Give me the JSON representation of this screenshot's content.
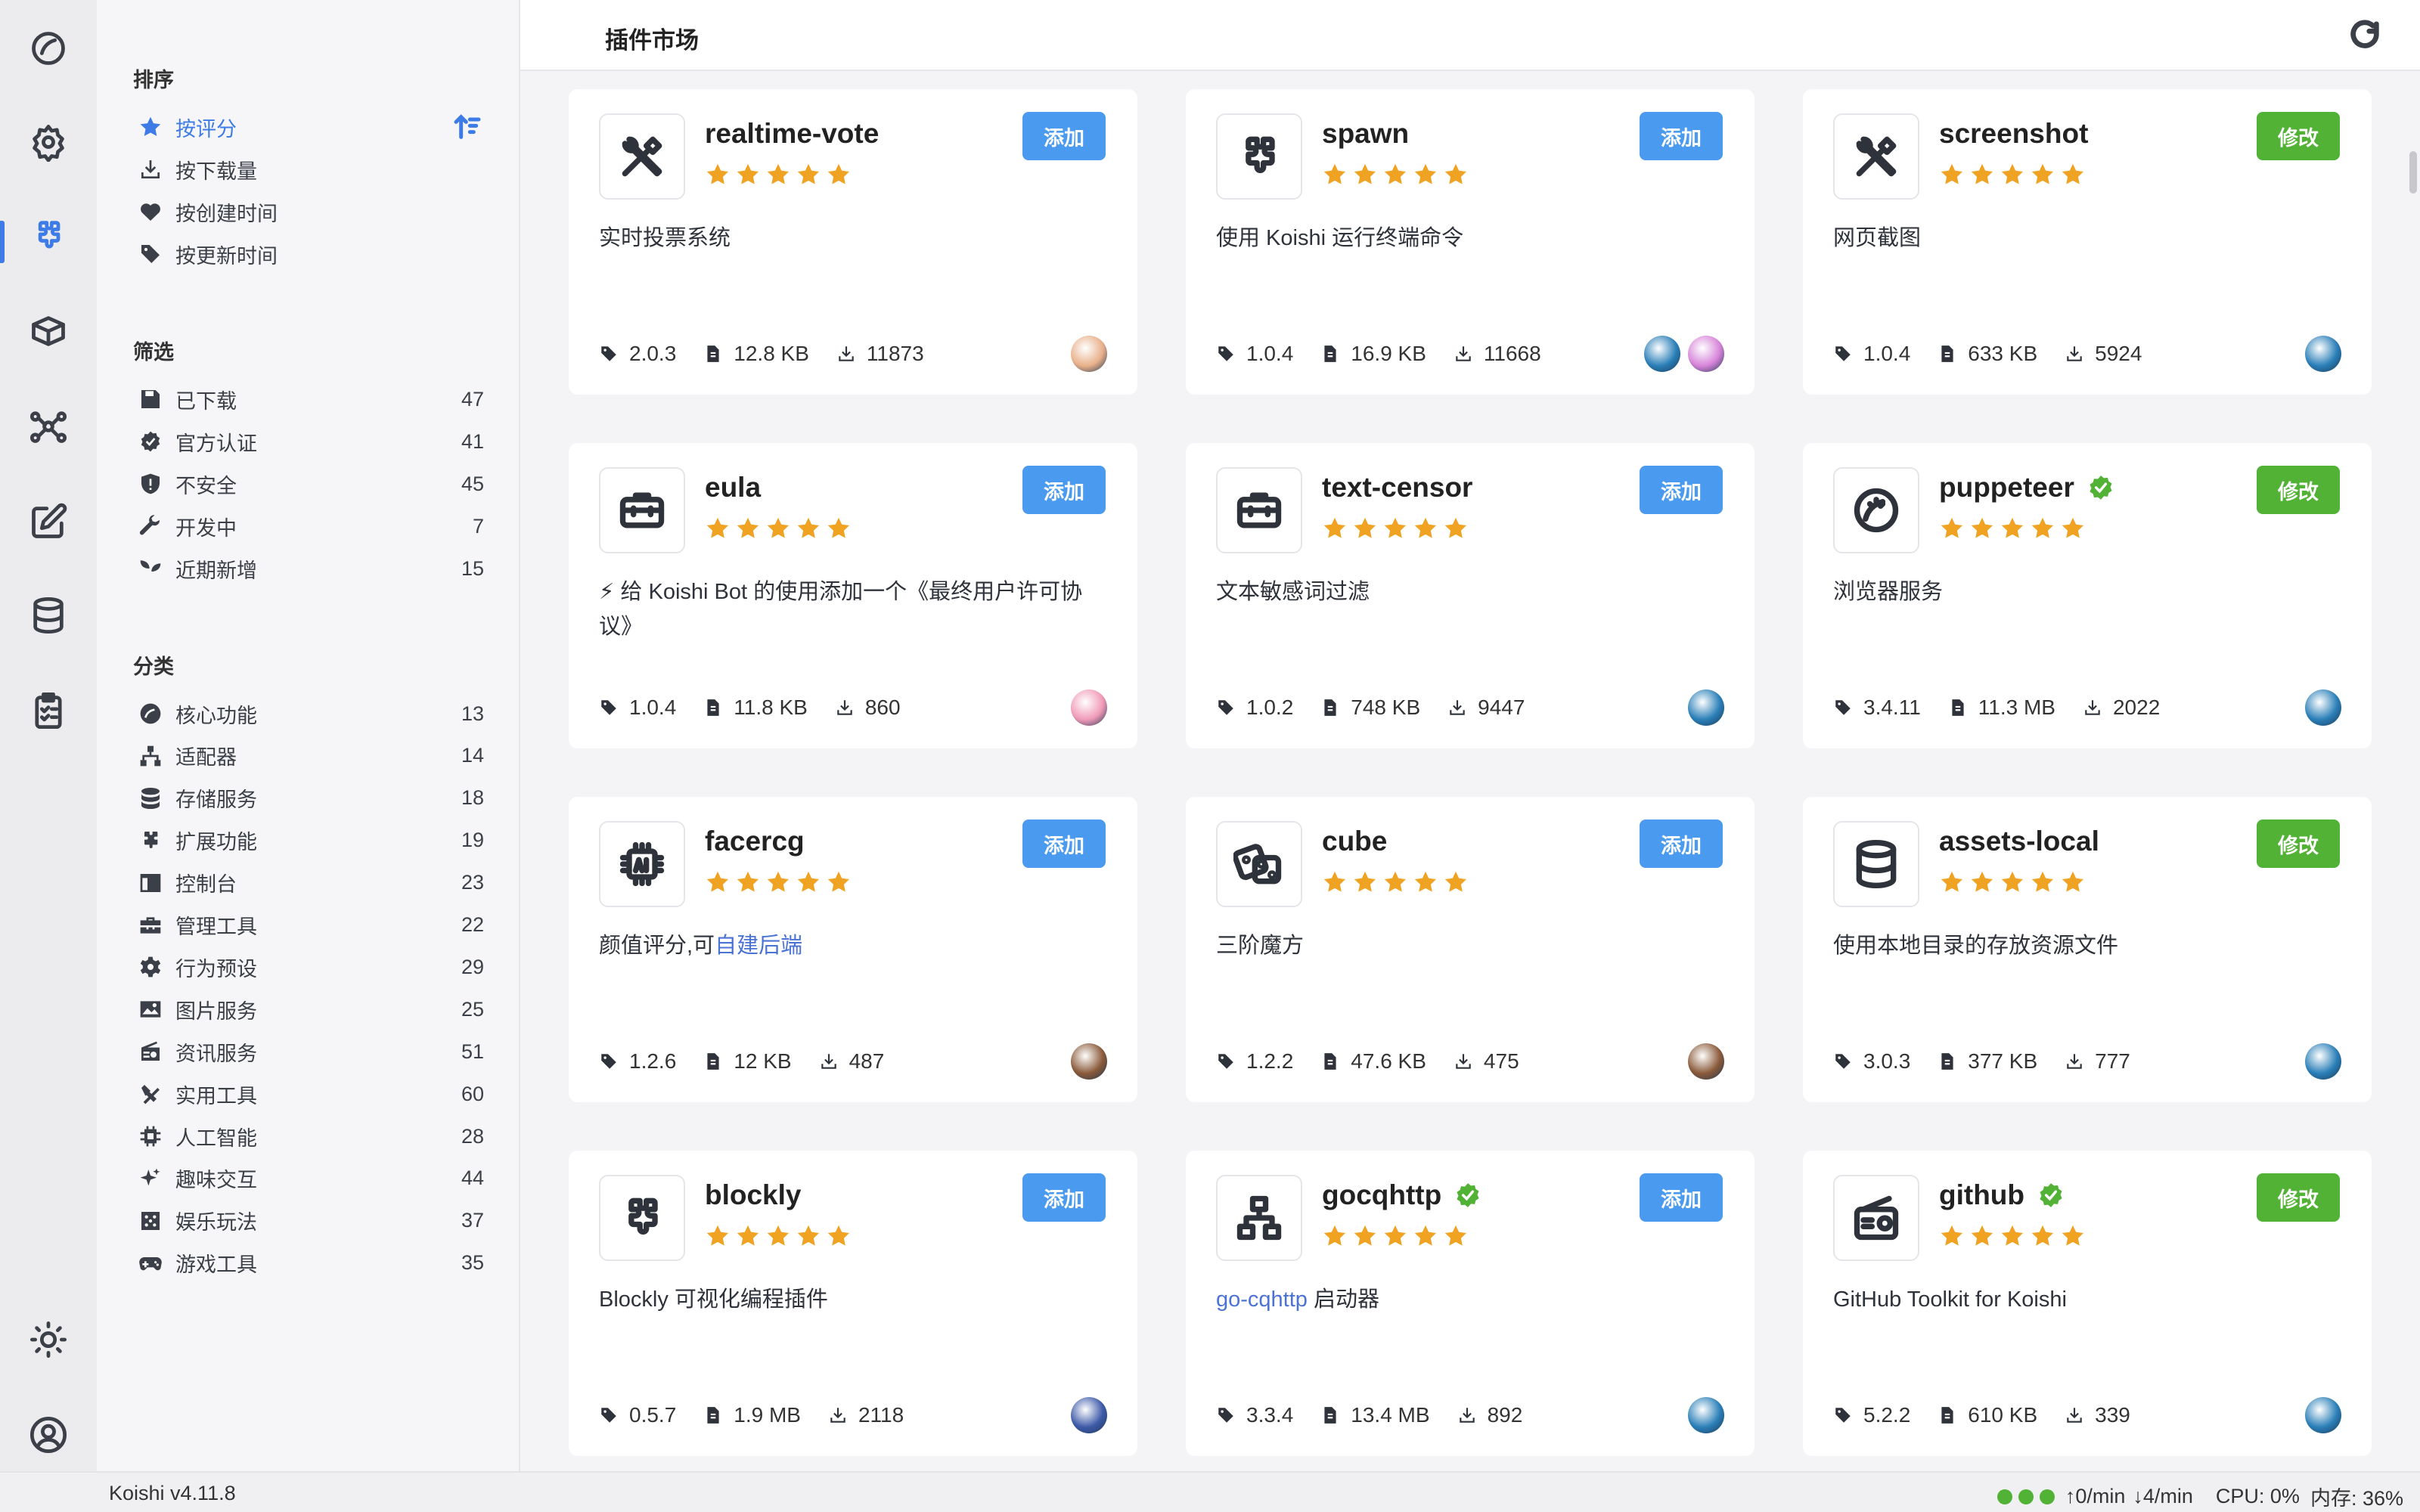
{
  "app": {
    "version": "Koishi v4.11.8"
  },
  "activity_bar": {
    "icons": [
      "dashboard-icon",
      "settings-icon",
      "plugin-icon",
      "package-icon",
      "network-icon",
      "edit-icon",
      "database-icon",
      "clipboard-icon",
      "theme-icon",
      "user-icon"
    ],
    "active": "plugin-icon"
  },
  "sidebar": {
    "sort_title": "排序",
    "sort": [
      {
        "label": "按评分",
        "icon": "star-icon",
        "active": true
      },
      {
        "label": "按下载量",
        "icon": "download-icon"
      },
      {
        "label": "按创建时间",
        "icon": "heart-pulse-icon"
      },
      {
        "label": "按更新时间",
        "icon": "tag-icon"
      }
    ],
    "filter_title": "筛选",
    "filters": [
      {
        "label": "已下载",
        "count": "47",
        "icon": "save-icon"
      },
      {
        "label": "官方认证",
        "count": "41",
        "icon": "badge-check-icon"
      },
      {
        "label": "不安全",
        "count": "45",
        "icon": "shield-alert-icon"
      },
      {
        "label": "开发中",
        "count": "7",
        "icon": "wrench-icon"
      },
      {
        "label": "近期新增",
        "count": "15",
        "icon": "seedling-icon"
      }
    ],
    "category_title": "分类",
    "categories": [
      {
        "label": "核心功能",
        "count": "13",
        "icon": "gauge-icon"
      },
      {
        "label": "适配器",
        "count": "14",
        "icon": "sitemap-icon"
      },
      {
        "label": "存储服务",
        "count": "18",
        "icon": "database-icon"
      },
      {
        "label": "扩展功能",
        "count": "19",
        "icon": "puzzle-icon"
      },
      {
        "label": "控制台",
        "count": "23",
        "icon": "console-icon"
      },
      {
        "label": "管理工具",
        "count": "22",
        "icon": "toolbox-icon"
      },
      {
        "label": "行为预设",
        "count": "29",
        "icon": "gear-icon"
      },
      {
        "label": "图片服务",
        "count": "25",
        "icon": "image-icon"
      },
      {
        "label": "资讯服务",
        "count": "51",
        "icon": "radio-icon"
      },
      {
        "label": "实用工具",
        "count": "60",
        "icon": "tools-icon"
      },
      {
        "label": "人工智能",
        "count": "28",
        "icon": "chip-icon"
      },
      {
        "label": "趣味交互",
        "count": "44",
        "icon": "sparkles-icon"
      },
      {
        "label": "娱乐玩法",
        "count": "37",
        "icon": "dice-icon"
      },
      {
        "label": "游戏工具",
        "count": "35",
        "icon": "gamepad-icon"
      }
    ]
  },
  "header": {
    "title": "插件市场"
  },
  "plugins": [
    {
      "name": "realtime-vote",
      "icon": "tools-icon",
      "action": "添加",
      "action_type": "add",
      "desc": "实时投票系统",
      "version": "2.0.3",
      "size": "12.8 KB",
      "downloads": "11873",
      "rating": 5,
      "avatars": [
        "#e8b08a"
      ]
    },
    {
      "name": "spawn",
      "icon": "puzzle-icon",
      "action": "添加",
      "action_type": "add",
      "desc": "使用 Koishi 运行终端命令",
      "version": "1.0.4",
      "size": "16.9 KB",
      "downloads": "11668",
      "rating": 5,
      "avatars": [
        "#2a7fb8",
        "#d784d9"
      ]
    },
    {
      "name": "screenshot",
      "icon": "tools-icon",
      "action": "修改",
      "action_type": "edit",
      "desc": "网页截图",
      "version": "1.0.4",
      "size": "633 KB",
      "downloads": "5924",
      "rating": 5,
      "avatars": [
        "#2a7fb8"
      ]
    },
    {
      "name": "eula",
      "icon": "toolbox-icon",
      "action": "添加",
      "action_type": "add",
      "desc": "⚡ 给 Koishi Bot 的使用添加一个《最终用户许可协议》",
      "version": "1.0.4",
      "size": "11.8 KB",
      "downloads": "860",
      "rating": 5,
      "avatars": [
        "#f09ab8"
      ]
    },
    {
      "name": "text-censor",
      "icon": "toolbox-icon",
      "action": "添加",
      "action_type": "add",
      "desc": "文本敏感词过滤",
      "version": "1.0.2",
      "size": "748 KB",
      "downloads": "9447",
      "rating": 5,
      "avatars": [
        "#2a7fb8"
      ]
    },
    {
      "name": "puppeteer",
      "icon": "gauge-icon",
      "action": "修改",
      "action_type": "edit",
      "verified": true,
      "desc": "浏览器服务",
      "version": "3.4.11",
      "size": "11.3 MB",
      "downloads": "2022",
      "rating": 5,
      "avatars": [
        "#2a7fb8"
      ]
    },
    {
      "name": "facercg",
      "icon": "chip-icon",
      "action": "添加",
      "action_type": "add",
      "desc": "颜值评分,可",
      "desc_link": "自建后端",
      "version": "1.2.6",
      "size": "12 KB",
      "downloads": "487",
      "rating": 5,
      "avatars": [
        "#8a5a3a"
      ]
    },
    {
      "name": "cube",
      "icon": "dice-icon",
      "action": "添加",
      "action_type": "add",
      "desc": "三阶魔方",
      "version": "1.2.2",
      "size": "47.6 KB",
      "downloads": "475",
      "rating": 5,
      "avatars": [
        "#8a5a3a"
      ]
    },
    {
      "name": "assets-local",
      "icon": "database-icon",
      "action": "修改",
      "action_type": "edit",
      "desc": "使用本地目录的存放资源文件",
      "version": "3.0.3",
      "size": "377 KB",
      "downloads": "777",
      "rating": 5,
      "avatars": [
        "#2a7fb8"
      ]
    },
    {
      "name": "blockly",
      "icon": "puzzle-icon",
      "action": "添加",
      "action_type": "add",
      "desc": "Blockly 可视化编程插件",
      "version": "0.5.7",
      "size": "1.9 MB",
      "downloads": "2118",
      "rating": 5,
      "avatars": [
        "#3d5aa8"
      ]
    },
    {
      "name": "gocqhttp",
      "icon": "sitemap-icon",
      "action": "添加",
      "action_type": "add",
      "verified": true,
      "desc_link_first": "go-cqhttp",
      "desc": " 启动器",
      "version": "3.3.4",
      "size": "13.4 MB",
      "downloads": "892",
      "rating": 5,
      "avatars": [
        "#2a7fb8"
      ]
    },
    {
      "name": "github",
      "icon": "radio-icon",
      "action": "修改",
      "action_type": "edit",
      "verified": true,
      "desc": "GitHub Toolkit for Koishi",
      "version": "5.2.2",
      "size": "610 KB",
      "downloads": "339",
      "rating": 5,
      "avatars": [
        "#2a7fb8"
      ]
    }
  ],
  "status": {
    "indicators": [
      "#52b235",
      "#52b235",
      "#52b235"
    ],
    "up": "0/min",
    "down": "4/min",
    "cpu": "CPU: 0%",
    "mem": "内存: 36%"
  }
}
